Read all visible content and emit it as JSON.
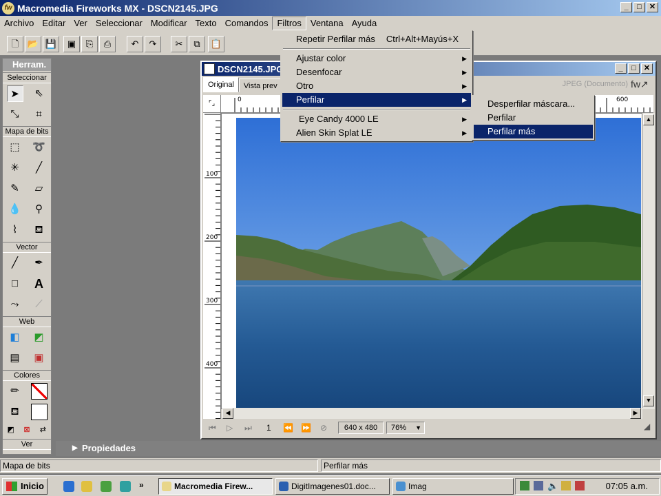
{
  "window": {
    "title": "Macromedia Fireworks MX - DSCN2145.JPG",
    "min": "_",
    "max": "□",
    "close": "✕"
  },
  "menubar": [
    "Archivo",
    "Editar",
    "Ver",
    "Seleccionar",
    "Modificar",
    "Texto",
    "Comandos",
    "Filtros",
    "Ventana",
    "Ayuda"
  ],
  "tools": {
    "title": "Herram.",
    "sections": {
      "select": "Seleccionar",
      "bitmap": "Mapa de bits",
      "vector": "Vector",
      "web": "Web",
      "colors": "Colores",
      "view": "Ver"
    }
  },
  "document": {
    "title": "DSCN2145.JPG",
    "tabs": [
      "Original",
      "Vista prev"
    ],
    "format": "JPEG (Documento)",
    "ruler_h": [
      "0",
      "600"
    ],
    "ruler_v": [
      "100",
      "200",
      "300",
      "400"
    ],
    "frame": "1",
    "size": "640 x 480",
    "zoom": "76%"
  },
  "filtros_menu": {
    "repeat": "Repetir Perfilar más",
    "repeat_shortcut": "Ctrl+Alt+Mayús+X",
    "items": [
      "Ajustar color",
      "Desenfocar",
      "Otro",
      "Perfilar"
    ],
    "plugins": [
      "Eye Candy 4000 LE",
      "Alien Skin Splat LE"
    ]
  },
  "perfilar_menu": [
    "Desperfilar máscara...",
    "Perfilar",
    "Perfilar más"
  ],
  "properties": {
    "label": "Propiedades"
  },
  "statusbar": {
    "left": "Mapa de bits",
    "right": "Perfilar más"
  },
  "taskbar": {
    "start": "Inicio",
    "tasks": [
      "Macromedia Firew...",
      "DigitImagenes01.doc...",
      "Imag"
    ],
    "clock": "07:05 a.m."
  }
}
